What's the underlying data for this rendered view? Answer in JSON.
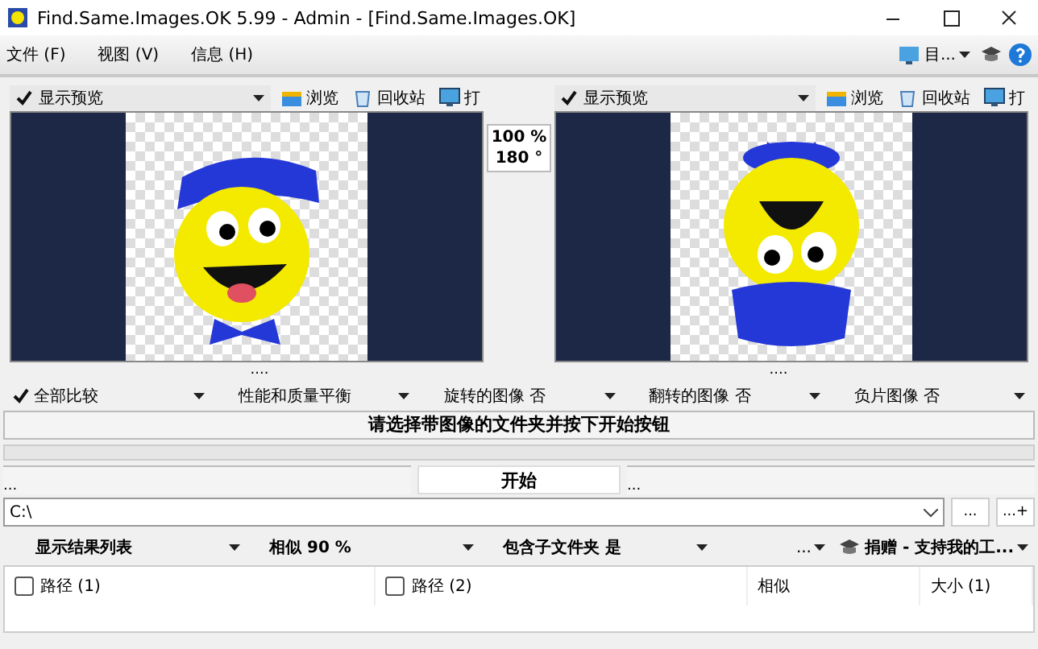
{
  "window": {
    "title": "Find.Same.Images.OK 5.99 - Admin - [Find.Same.Images.OK]"
  },
  "menu": [
    "文件 (F)",
    "视图 (V)",
    "信息 (H)"
  ],
  "menu_tools": {
    "language_label": "目..."
  },
  "panes": [
    {
      "preview": {
        "label": "显示预览",
        "checked": true
      },
      "buttons": [
        "浏览",
        "回收站",
        "打"
      ]
    },
    {
      "preview": {
        "label": "显示预览",
        "checked": true
      },
      "buttons": [
        "浏览",
        "回收站",
        "打"
      ]
    }
  ],
  "zoom_info": [
    "100 %",
    "180 °"
  ],
  "splitters": [
    "....",
    "...."
  ],
  "compare_options": [
    {
      "label": "全部比较",
      "checked": true
    },
    {
      "label": "性能和质量平衡",
      "checked": false
    },
    {
      "label": "旋转的图像 否",
      "checked": false
    },
    {
      "label": "翻转的图像 否",
      "checked": false
    },
    {
      "label": "负片图像 否",
      "checked": false
    }
  ],
  "status": "请选择带图像的文件夹并按下开始按钮",
  "progress": {
    "level": 0
  },
  "start_row": {
    "left": "...",
    "button": "开始",
    "right": "..."
  },
  "path": {
    "value": "C:\\",
    "buttons": [
      "...",
      "...+"
    ]
  },
  "result_options": [
    "显示结果列表",
    "相似 90 %",
    "包含子文件夹 是"
  ],
  "donate": {
    "more": "...",
    "label": "捐赠 - 支持我的工..."
  },
  "table": {
    "columns": [
      {
        "label": "路径 (1)",
        "kind": "checkbox",
        "checked": false
      },
      {
        "label": "路径 (2)",
        "kind": "checkbox",
        "checked": false
      },
      {
        "label": "相似",
        "kind": "text"
      },
      {
        "label": "大小 (1)",
        "kind": "text"
      }
    ]
  }
}
